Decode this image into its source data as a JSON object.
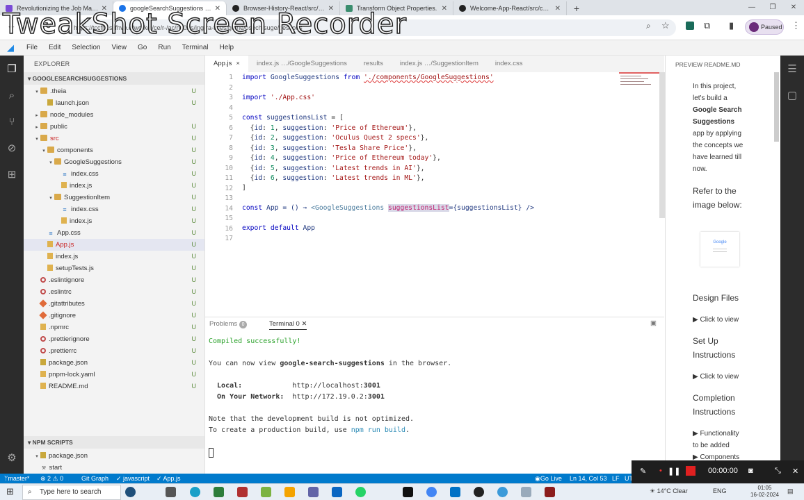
{
  "browser": {
    "tabs": [
      {
        "title": "Revolutionizing the Job Market",
        "color": "#7a4bd6"
      },
      {
        "title": "googleSearchSuggestions — C",
        "color": "#1a73e8",
        "active": true
      },
      {
        "title": "Browser-History-React/src/com",
        "color": "#222222"
      },
      {
        "title": "Transform Object Properties.",
        "color": "#3a8d6e"
      },
      {
        "title": "Welcome-App-React/src/comp",
        "color": "#222222"
      }
    ],
    "url": "https://tccfhr.silfhvb.e/work/c/ce/r-/ac/ry/0/rs/ing-ra-tices/gc/ne/osech/suge/gestions",
    "watermark": "TweakShot Screen Recorder",
    "paused_label": "Paused",
    "new_tab": "+"
  },
  "menu": [
    "File",
    "Edit",
    "Selection",
    "View",
    "Go",
    "Run",
    "Terminal",
    "Help"
  ],
  "explorer": {
    "header": "EXPLORER",
    "root": "GOOGLESEARCHSUGGESTIONS",
    "items": [
      {
        "label": ".theia",
        "depth": 1,
        "type": "folder",
        "open": true,
        "badge": "U"
      },
      {
        "label": "launch.json",
        "depth": 2,
        "type": "json",
        "badge": "U"
      },
      {
        "label": "node_modules",
        "depth": 1,
        "type": "folder",
        "open": false,
        "badge": ""
      },
      {
        "label": "public",
        "depth": 1,
        "type": "folder",
        "open": false,
        "badge": "U"
      },
      {
        "label": "src",
        "depth": 1,
        "type": "folder",
        "open": true,
        "badge": "U",
        "err": true
      },
      {
        "label": "components",
        "depth": 2,
        "type": "folder",
        "open": true,
        "badge": "U"
      },
      {
        "label": "GoogleSuggestions",
        "depth": 3,
        "type": "folder",
        "open": true,
        "badge": "U"
      },
      {
        "label": "index.css",
        "depth": 4,
        "type": "css",
        "badge": "U"
      },
      {
        "label": "index.js",
        "depth": 4,
        "type": "file",
        "badge": "U"
      },
      {
        "label": "SuggestionItem",
        "depth": 3,
        "type": "folder",
        "open": true,
        "badge": "U"
      },
      {
        "label": "index.css",
        "depth": 4,
        "type": "css",
        "badge": "U"
      },
      {
        "label": "index.js",
        "depth": 4,
        "type": "file",
        "badge": "U"
      },
      {
        "label": "App.css",
        "depth": 2,
        "type": "css",
        "badge": "U"
      },
      {
        "label": "App.js",
        "depth": 2,
        "type": "file",
        "badge": "U",
        "err": true,
        "selected": true
      },
      {
        "label": "index.js",
        "depth": 2,
        "type": "file",
        "badge": "U"
      },
      {
        "label": "setupTests.js",
        "depth": 2,
        "type": "file",
        "badge": "U"
      },
      {
        "label": ".eslintignore",
        "depth": 1,
        "type": "dot",
        "badge": "U"
      },
      {
        "label": ".eslintrc",
        "depth": 1,
        "type": "dot",
        "badge": "U"
      },
      {
        "label": ".gitattributes",
        "depth": 1,
        "type": "git",
        "badge": "U"
      },
      {
        "label": ".gitignore",
        "depth": 1,
        "type": "git",
        "badge": "U"
      },
      {
        "label": ".npmrc",
        "depth": 1,
        "type": "file",
        "badge": "U"
      },
      {
        "label": ".prettierignore",
        "depth": 1,
        "type": "dot",
        "badge": "U"
      },
      {
        "label": ".prettierrc",
        "depth": 1,
        "type": "dot",
        "badge": "U"
      },
      {
        "label": "package.json",
        "depth": 1,
        "type": "json",
        "badge": "U"
      },
      {
        "label": "pnpm-lock.yaml",
        "depth": 1,
        "type": "file",
        "badge": "U"
      },
      {
        "label": "README.md",
        "depth": 1,
        "type": "file",
        "badge": "U"
      }
    ],
    "npm_header": "NPM SCRIPTS",
    "npm_items": [
      "package.json",
      "start"
    ]
  },
  "editor": {
    "tabs": [
      {
        "label": "App.js",
        "active": true,
        "close": "×"
      },
      {
        "label": "index.js …/GoogleSuggestions"
      },
      {
        "label": "results"
      },
      {
        "label": "index.js …/SuggestionItem"
      },
      {
        "label": "index.css"
      }
    ],
    "code": {
      "l1_import": "import",
      "l1_name": " GoogleSuggestions ",
      "l1_from": "from",
      "l1_path": "'./components/GoogleSuggestions'",
      "l3_import": "import",
      "l3_path": " './App.css'",
      "l5_const": "const",
      "l5_name": " suggestionsList",
      "l5_rest": " = [",
      "items": [
        {
          "id": "1",
          "text": "'Price of Ethereum'"
        },
        {
          "id": "2",
          "text": "'Oculus Quest 2 specs'"
        },
        {
          "id": "3",
          "text": "'Tesla Share Price'"
        },
        {
          "id": "4",
          "text": "'Price of Ethereum today'"
        },
        {
          "id": "5",
          "text": "'Latest trends in AI'"
        },
        {
          "id": "6",
          "text": "'Latest trends in ML'"
        }
      ],
      "l12": "]",
      "l14_const": "const",
      "l14_name": " App = () ⇒ ",
      "l14_tag": "<GoogleSuggestions ",
      "l14_attr": "suggestionsList",
      "l14_rest": "={suggestionsList} />",
      "l16_export": "export default",
      "l16_name": " App"
    }
  },
  "panel": {
    "problems_label": "Problems",
    "problems_count": "0",
    "terminal_label": "Terminal 0",
    "compiled": "Compiled successfully!",
    "view_prefix": "You can now view ",
    "app_name": "google-search-suggestions",
    "view_suffix": " in the browser.",
    "local_label": "  Local:            ",
    "local_url": "http://localhost:",
    "local_port": "3001",
    "net_label": "  On Your Network:  ",
    "net_url": "http://172.19.0.2:",
    "net_port": "3001",
    "note1": "Note that the development build is not optimized.",
    "note2_prefix": "To create a production build, use ",
    "note2_cmd": "npm run build",
    "note2_suffix": "."
  },
  "preview": {
    "header": "PREVIEW README.MD",
    "intro": [
      "In this project,",
      "let's build a"
    ],
    "intro_bold": [
      "Google Search",
      "Suggestions"
    ],
    "intro_rest": [
      "app by applying",
      "the concepts we",
      "have learned till",
      "now."
    ],
    "refer": [
      "Refer to the",
      "image below:"
    ],
    "image_label": "Google",
    "design": "Design Files",
    "click1": "Click to view",
    "setup": [
      "Set Up",
      "Instructions"
    ],
    "click2": "Click to view",
    "completion": [
      "Completion",
      "Instructions"
    ],
    "func": [
      "Functionality",
      "to be added"
    ],
    "components": "Components"
  },
  "status": {
    "branch": "master*",
    "problems": "⊗ 2 ⚠ 0",
    "gitgraph": "Git Graph",
    "lang": "✓ javascript",
    "file": "✓ App.js",
    "golive": "Go Live",
    "pos": "Ln 14, Col 53",
    "eol": "LF",
    "ut": "UT"
  },
  "recorder": {
    "time": "00:00:00"
  },
  "taskbar": {
    "search": "Type here to search",
    "weather": "14°C  Clear",
    "lang": "ENG",
    "time": "01:05",
    "date": "16-02-2024"
  }
}
